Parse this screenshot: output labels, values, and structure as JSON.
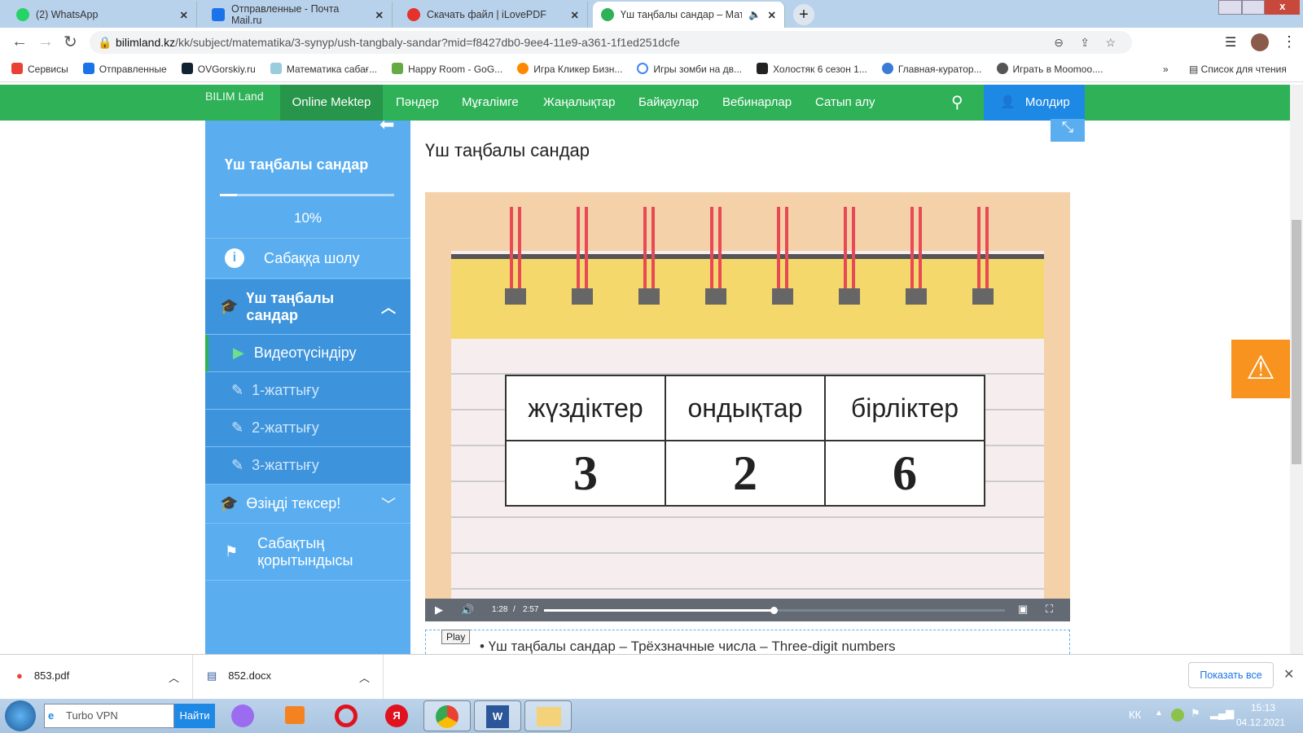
{
  "tabs": [
    {
      "label": "(2) WhatsApp"
    },
    {
      "label": "Отправленные - Почта Mail.ru"
    },
    {
      "label": "Скачать файл | iLovePDF"
    },
    {
      "label": "Үш таңбалы сандар – Матем"
    }
  ],
  "url": {
    "domain": "bilimland.kz",
    "path": "/kk/subject/matematika/3-synyp/ush-tangbaly-sandar?mid=f8427db0-9ee4-11e9-a361-1f1ed251dcfe"
  },
  "bookmarks": [
    "Сервисы",
    "Отправленные",
    "OVGorskiy.ru",
    "Математика сабағ...",
    "Happy Room - GoG...",
    "Игра Кликер Бизн...",
    "Игры зомби на дв...",
    "Холостяк 6 сезон 1...",
    "Главная-куратор...",
    "Играть в Moomoo...."
  ],
  "reading_list": "Список для чтения",
  "site": {
    "logo": "BILIM Land",
    "nav": [
      "Online Mektep",
      "Пәндер",
      "Мұғалімге",
      "Жаңалықтар",
      "Байқаулар",
      "Вебинарлар",
      "Сатып алу"
    ],
    "user": "Молдир"
  },
  "sidebar": {
    "title": "Үш таңбалы сандар",
    "progress_label": "10%",
    "progress": 0.1,
    "items": [
      "Сабаққа шолу",
      "Үш таңбалы сандар",
      "Видеотүсіндіру",
      "1-жаттығу",
      "2-жаттығу",
      "3-жаттығу",
      "Өзіңді тексер!",
      "Сабақтың қорытындысы"
    ]
  },
  "main": {
    "title": "Үш таңбалы сандар",
    "table": {
      "headers": [
        "жүздіктер",
        "ондықтар",
        "бірліктер"
      ],
      "values": [
        "3",
        "2",
        "6"
      ]
    },
    "video": {
      "current": "1:28",
      "duration": "2:57",
      "progress": 0.5,
      "tooltip": "Play"
    },
    "caption": "Үш таңбалы сандар – Трёхзначные числа – Three-digit numbers"
  },
  "downloads": [
    {
      "name": "853.pdf"
    },
    {
      "name": "852.docx"
    }
  ],
  "show_all": "Показать все",
  "taskbar": {
    "search_value": "Turbo VPN",
    "search_button": "Найти",
    "lang": "КК",
    "time": "15:13",
    "date": "04.12.2021"
  }
}
